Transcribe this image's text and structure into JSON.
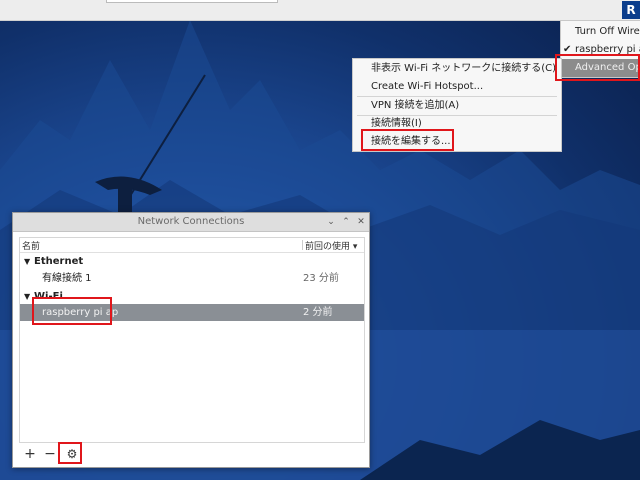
{
  "tray": {
    "items": [
      {
        "label": "Turn Off Wireless",
        "checked": false
      },
      {
        "label": "raspberry pi ap",
        "checked": true
      },
      {
        "label": "Advanced Options",
        "checked": false
      }
    ],
    "icon_glyph": "R"
  },
  "advanced_menu": {
    "items": [
      {
        "label": "非表示 Wi-Fi ネットワークに接続する(C)"
      },
      {
        "label": "Create Wi-Fi Hotspot..."
      },
      {
        "label": "VPN 接続を追加(A)"
      },
      {
        "label": "接続情報(I)"
      },
      {
        "label": "接続を編集する..."
      }
    ]
  },
  "window": {
    "title": "Network Connections",
    "controls": {
      "minimize": "⌄",
      "maximize": "⌃",
      "close": "✕"
    },
    "columns": {
      "name": "名前",
      "last_used": "前回の使用 ▾"
    },
    "groups": [
      {
        "name": "Ethernet",
        "connections": [
          {
            "name": "有線接続 1",
            "last_used": "23 分前"
          }
        ]
      },
      {
        "name": "Wi-Fi",
        "connections": [
          {
            "name": "raspberry pi ap",
            "last_used": "2 分前"
          }
        ]
      }
    ],
    "toolbar": {
      "add": "+",
      "remove": "−",
      "settings": "⚙"
    }
  },
  "colors": {
    "highlight": "#e0161b",
    "selection": "#8a8f95",
    "brand_icon": "#0b3d8c"
  }
}
